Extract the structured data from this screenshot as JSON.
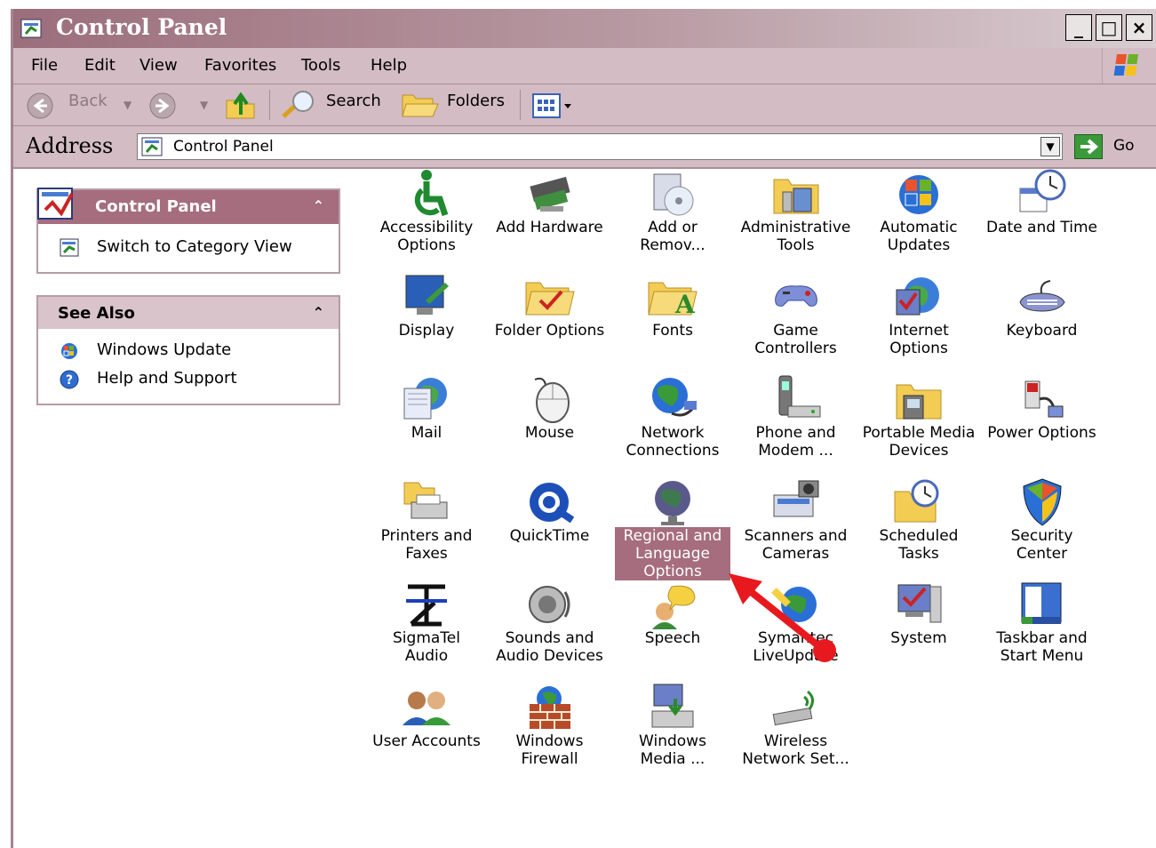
{
  "window": {
    "title": "Control Panel",
    "min": "_",
    "max": "□",
    "close": "×"
  },
  "menu": [
    {
      "label": "File",
      "key": "F"
    },
    {
      "label": "Edit",
      "key": "E"
    },
    {
      "label": "View",
      "key": "V"
    },
    {
      "label": "Favorites",
      "key": "a"
    },
    {
      "label": "Tools",
      "key": "T"
    },
    {
      "label": "Help",
      "key": "H"
    }
  ],
  "toolbar": {
    "back": "Back",
    "search": "Search",
    "folders": "Folders"
  },
  "address": {
    "label": "Address",
    "value": "Control Panel",
    "go": "Go"
  },
  "task_pane": {
    "control_panel": {
      "title": "Control Panel",
      "switch": "Switch to Category View"
    },
    "see_also": {
      "title": "See Also",
      "links": [
        "Windows Update",
        "Help and Support"
      ]
    }
  },
  "items": [
    {
      "label": "Accessibility\nOptions",
      "icon": "accessibility-icon"
    },
    {
      "label": "Add Hardware",
      "icon": "add-hardware-icon"
    },
    {
      "label": "Add or\nRemov...",
      "icon": "add-remove-programs-icon"
    },
    {
      "label": "Administrative\nTools",
      "icon": "administrative-tools-icon"
    },
    {
      "label": "Automatic\nUpdates",
      "icon": "automatic-updates-icon"
    },
    {
      "label": "Date and Time",
      "icon": "date-time-icon"
    },
    {
      "label": "Display",
      "icon": "display-icon"
    },
    {
      "label": "Folder Options",
      "icon": "folder-options-icon"
    },
    {
      "label": "Fonts",
      "icon": "fonts-icon"
    },
    {
      "label": "Game\nControllers",
      "icon": "game-controllers-icon"
    },
    {
      "label": "Internet\nOptions",
      "icon": "internet-options-icon"
    },
    {
      "label": "Keyboard",
      "icon": "keyboard-icon"
    },
    {
      "label": "Mail",
      "icon": "mail-icon"
    },
    {
      "label": "Mouse",
      "icon": "mouse-icon"
    },
    {
      "label": "Network\nConnections",
      "icon": "network-connections-icon"
    },
    {
      "label": "Phone and\nModem ...",
      "icon": "phone-modem-icon"
    },
    {
      "label": "Portable Media\nDevices",
      "icon": "portable-media-icon"
    },
    {
      "label": "Power Options",
      "icon": "power-options-icon"
    },
    {
      "label": "Printers and\nFaxes",
      "icon": "printers-faxes-icon"
    },
    {
      "label": "QuickTime",
      "icon": "quicktime-icon"
    },
    {
      "label": "Regional and\nLanguage\nOptions",
      "icon": "regional-language-icon",
      "selected": true
    },
    {
      "label": "Scanners and\nCameras",
      "icon": "scanners-cameras-icon"
    },
    {
      "label": "Scheduled\nTasks",
      "icon": "scheduled-tasks-icon"
    },
    {
      "label": "Security\nCenter",
      "icon": "security-center-icon"
    },
    {
      "label": "SigmaTel\nAudio",
      "icon": "sigmatel-audio-icon"
    },
    {
      "label": "Sounds and\nAudio Devices",
      "icon": "sounds-audio-icon"
    },
    {
      "label": "Speech",
      "icon": "speech-icon"
    },
    {
      "label": "Symantec\nLiveUpdate",
      "icon": "symantec-liveupdate-icon"
    },
    {
      "label": "System",
      "icon": "system-icon"
    },
    {
      "label": "Taskbar and\nStart Menu",
      "icon": "taskbar-start-menu-icon"
    },
    {
      "label": "User Accounts",
      "icon": "user-accounts-icon"
    },
    {
      "label": "Windows\nFirewall",
      "icon": "windows-firewall-icon"
    },
    {
      "label": "Windows\nMedia ...",
      "icon": "windows-media-icon"
    },
    {
      "label": "Wireless\nNetwork Set...",
      "icon": "wireless-network-icon"
    }
  ],
  "colors": {
    "accent": "#a56d7e",
    "chrome": "#d3bcc3",
    "pointer_arrow": "#e8191e"
  }
}
